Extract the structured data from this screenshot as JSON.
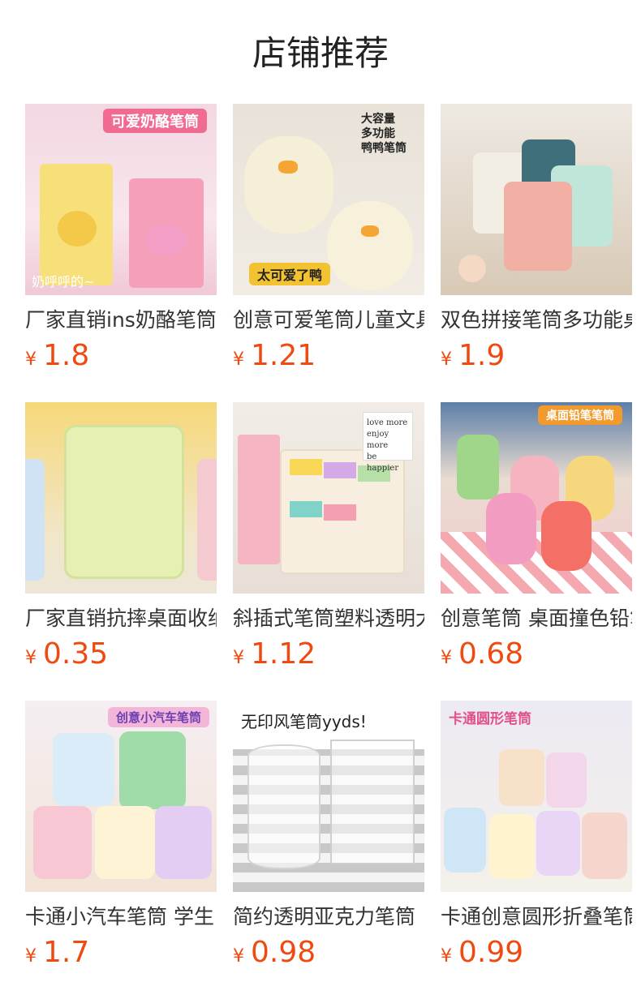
{
  "page": {
    "title": "店铺推荐"
  },
  "currency": "¥",
  "products": [
    {
      "name": "厂家直销ins奶酪笔筒",
      "price": "1.8",
      "image_text": [
        "可爱奶酪笔筒",
        "奶呼呼的~"
      ]
    },
    {
      "name": "创意可爱笔筒儿童文具",
      "price": "1.21",
      "image_text": [
        "大容量",
        "多功能",
        "鸭鸭笔筒",
        "太可爱了鸭"
      ]
    },
    {
      "name": "双色拼接笔筒多功能桌",
      "price": "1.9",
      "image_text": []
    },
    {
      "name": "厂家直销抗摔桌面收纳",
      "price": "0.35",
      "image_text": []
    },
    {
      "name": "斜插式笔筒塑料透明大",
      "price": "1.12",
      "image_text": [
        "love more",
        "enjoy more",
        "be happier"
      ]
    },
    {
      "name": "创意笔筒 桌面撞色铅笔",
      "price": "0.68",
      "image_text": [
        "桌面铅笔笔筒"
      ]
    },
    {
      "name": "卡通小汽车笔筒 学生",
      "price": "1.7",
      "image_text": [
        "创意小汽车笔筒"
      ]
    },
    {
      "name": "简约透明亚克力笔筒",
      "price": "0.98",
      "image_text": [
        "无印风笔筒yyds!"
      ]
    },
    {
      "name": "卡通创意圆形折叠笔筒",
      "price": "0.99",
      "image_text": [
        "卡通圆形笔筒"
      ]
    }
  ]
}
